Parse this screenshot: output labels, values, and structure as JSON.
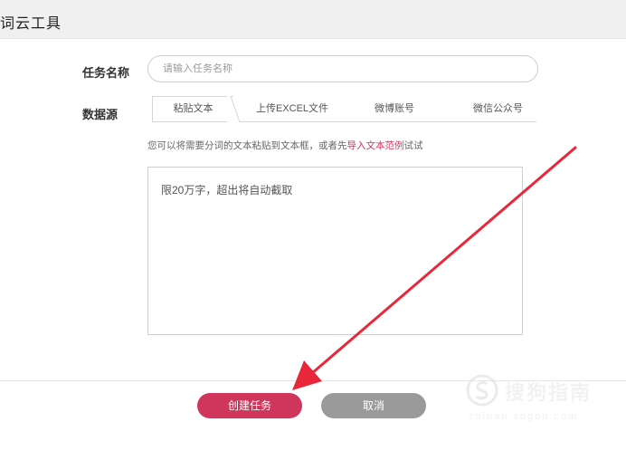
{
  "header": {
    "title": "词云工具"
  },
  "form": {
    "task_name_label": "任务名称",
    "task_name_placeholder": "请输入任务名称",
    "data_source_label": "数据源",
    "tabs": [
      {
        "label": "粘贴文本",
        "active": true
      },
      {
        "label": "上传EXCEL文件",
        "active": false
      },
      {
        "label": "微博账号",
        "active": false
      },
      {
        "label": "微信公众号",
        "active": false
      }
    ],
    "hint_prefix": "您可以将需要分词的文本粘贴到文本框，或者先",
    "hint_link": "导入文本范例",
    "hint_suffix": "试试",
    "textarea_placeholder": "限20万字，超出将自动截取"
  },
  "actions": {
    "create_label": "创建任务",
    "cancel_label": "取消"
  },
  "watermark": {
    "brand": "搜狗指南",
    "url": "zhinan.sogou.com"
  },
  "colors": {
    "accent": "#d0365b",
    "cancel": "#9a9a9a",
    "arrow": "#e8283a"
  }
}
